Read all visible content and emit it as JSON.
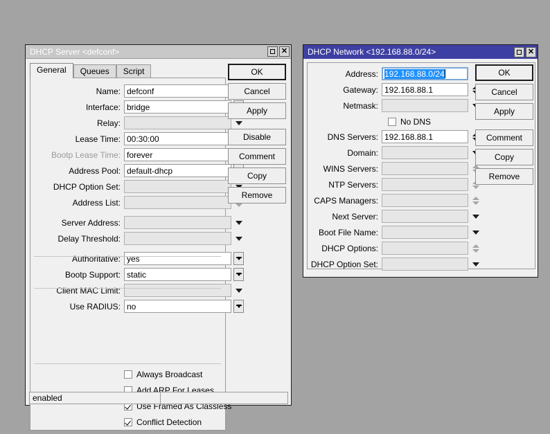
{
  "desktop": {
    "background": "#a3a3a3"
  },
  "colors": {
    "active_title": "#3e3fa2",
    "inactive_title": "#c8c8c8",
    "selection": "#1e90ff",
    "face": "#f0f0f0",
    "disabled_field": "#e6e6e6"
  },
  "server_window": {
    "title": "DHCP Server <defconf>",
    "maximize_icon": "maximize-icon",
    "close_icon": "close-icon",
    "tabs": [
      {
        "label": "General",
        "selected": true
      },
      {
        "label": "Queues",
        "selected": false
      },
      {
        "label": "Script",
        "selected": false
      }
    ],
    "fields": [
      {
        "label": "Name:",
        "value": "defconf",
        "control": "none",
        "disabled": false
      },
      {
        "label": "Interface:",
        "value": "bridge",
        "control": "combo",
        "disabled": false
      },
      {
        "label": "Relay:",
        "value": "",
        "control": "tri",
        "disabled": true
      },
      {
        "label": "Lease Time:",
        "value": "00:30:00",
        "control": "none",
        "disabled": false
      },
      {
        "label": "Bootp Lease Time:",
        "value": "forever",
        "control": "combo",
        "disabled": false,
        "label_dim": true
      },
      {
        "label": "Address Pool:",
        "value": "default-dhcp",
        "control": "combo",
        "disabled": false
      },
      {
        "label": "DHCP Option Set:",
        "value": "",
        "control": "tri",
        "disabled": true
      },
      {
        "label": "Address List:",
        "value": "",
        "control": "spin",
        "disabled": true
      },
      {
        "label": "Server Address:",
        "value": "",
        "control": "tri",
        "disabled": true
      },
      {
        "label": "Delay Threshold:",
        "value": "",
        "control": "tri",
        "disabled": true
      },
      {
        "label": "Authoritative:",
        "value": "yes",
        "control": "combo",
        "disabled": false
      },
      {
        "label": "Bootp Support:",
        "value": "static",
        "control": "combo",
        "disabled": false
      },
      {
        "label": "Client MAC Limit:",
        "value": "",
        "control": "tri",
        "disabled": true
      },
      {
        "label": "Use RADIUS:",
        "value": "no",
        "control": "combo",
        "disabled": false
      }
    ],
    "checkboxes": [
      {
        "label": "Always Broadcast",
        "checked": false
      },
      {
        "label": "Add ARP For Leases",
        "checked": false
      },
      {
        "label": "Use Framed As Classless",
        "checked": true
      },
      {
        "label": "Conflict Detection",
        "checked": true
      }
    ],
    "buttons": [
      {
        "label": "OK",
        "default": true
      },
      {
        "label": "Cancel",
        "default": false
      },
      {
        "label": "Apply",
        "default": false
      },
      {
        "label": "Disable",
        "default": false
      },
      {
        "label": "Comment",
        "default": false
      },
      {
        "label": "Copy",
        "default": false
      },
      {
        "label": "Remove",
        "default": false
      }
    ],
    "status": {
      "left": "enabled",
      "right": ""
    }
  },
  "network_window": {
    "title": "DHCP Network <192.168.88.0/24>",
    "maximize_icon": "maximize-icon",
    "close_icon": "close-icon",
    "fields": [
      {
        "label": "Address:",
        "value": "192.168.88.0/24",
        "control": "none",
        "disabled": false,
        "focused": true,
        "selected": true
      },
      {
        "label": "Gateway:",
        "value": "192.168.88.1",
        "control": "spin",
        "disabled": false
      },
      {
        "label": "Netmask:",
        "value": "",
        "control": "tri",
        "disabled": true
      },
      {
        "label": "DNS Servers:",
        "value": "192.168.88.1",
        "control": "spin",
        "disabled": false
      },
      {
        "label": "Domain:",
        "value": "",
        "control": "tri",
        "disabled": true
      },
      {
        "label": "WINS Servers:",
        "value": "",
        "control": "spin",
        "disabled": true
      },
      {
        "label": "NTP Servers:",
        "value": "",
        "control": "spin",
        "disabled": true
      },
      {
        "label": "CAPS Managers:",
        "value": "",
        "control": "spin",
        "disabled": true
      },
      {
        "label": "Next Server:",
        "value": "",
        "control": "tri",
        "disabled": true
      },
      {
        "label": "Boot File Name:",
        "value": "",
        "control": "tri",
        "disabled": true
      },
      {
        "label": "DHCP Options:",
        "value": "",
        "control": "spin",
        "disabled": true
      },
      {
        "label": "DHCP Option Set:",
        "value": "",
        "control": "tri",
        "disabled": true
      }
    ],
    "checkboxes": [
      {
        "label": "No DNS",
        "checked": false
      }
    ],
    "buttons": [
      {
        "label": "OK",
        "default": true
      },
      {
        "label": "Cancel",
        "default": false
      },
      {
        "label": "Apply",
        "default": false
      },
      {
        "label": "Comment",
        "default": false
      },
      {
        "label": "Copy",
        "default": false
      },
      {
        "label": "Remove",
        "default": false
      }
    ]
  }
}
